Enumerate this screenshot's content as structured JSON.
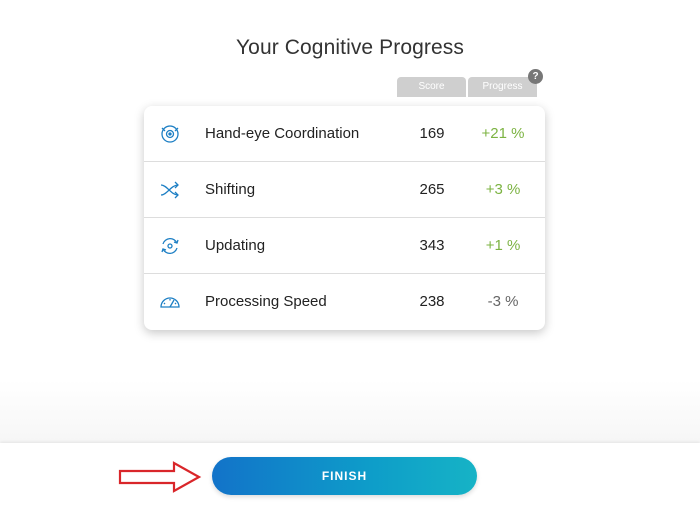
{
  "page": {
    "title": "Your Cognitive Progress"
  },
  "columns": {
    "score_label": "Score",
    "progress_label": "Progress",
    "help_label": "?"
  },
  "rows": [
    {
      "label": "Hand-eye Coordination",
      "score": "169",
      "progress": "+21 %",
      "icon": "target-eye-icon",
      "trend": "positive"
    },
    {
      "label": "Shifting",
      "score": "265",
      "progress": "+3 %",
      "icon": "shuffle-icon",
      "trend": "positive"
    },
    {
      "label": "Updating",
      "score": "343",
      "progress": "+1 %",
      "icon": "refresh-cycle-icon",
      "trend": "positive"
    },
    {
      "label": "Processing Speed",
      "score": "238",
      "progress": "-3 %",
      "icon": "speedometer-icon",
      "trend": "negative"
    }
  ],
  "footer": {
    "finish_label": "FINISH"
  },
  "colors": {
    "positive": "#7cb342",
    "negative": "#666666",
    "icon": "#1d7fc4",
    "arrow": "#d9262a",
    "header": "#cfcfcf"
  }
}
